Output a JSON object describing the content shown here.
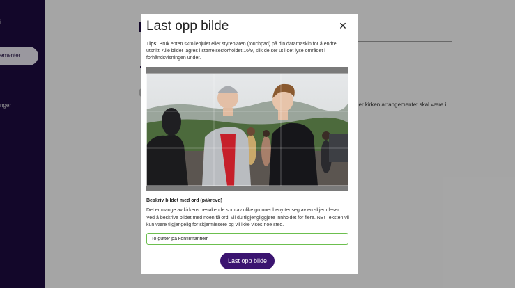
{
  "background": {
    "sidebar_dot": "i",
    "sidebar_active_label": "ementer",
    "sidebar_item2_label": "nger",
    "side_text": "ller kirken arrangementet skal være i."
  },
  "modal": {
    "title": "Last opp bilde",
    "close_label": "✕",
    "tips_label": "Tips:",
    "tips_text": " Bruk enten skrollehjulet eller styreplaten (touchpad) på din datamaskin for å endre utsnitt. Alle bilder lagres i størrelsesforholdet 16/9, slik de ser ut i det lyse området i forhåndsvisningen under.",
    "alt_label": "Beskriv bildet med ord (påkrevd)",
    "alt_description": "Det er mange av kirkens besøkende som av ulike grunner benytter seg av en skjermleser. Ved å beskrive bildet med noen få ord, vil du tilgjengliggjøre innholdet for flere. NB! Teksten vil kun være tilgjengelig for skjermlesere og vil ikke vises noe sted.",
    "alt_value": "To gutter på konfirmantleir",
    "upload_label": "Last opp bilde"
  },
  "colors": {
    "brand": "#3b1470",
    "sidebar": "#1d0b3f",
    "input_border": "#6cbf4e"
  }
}
